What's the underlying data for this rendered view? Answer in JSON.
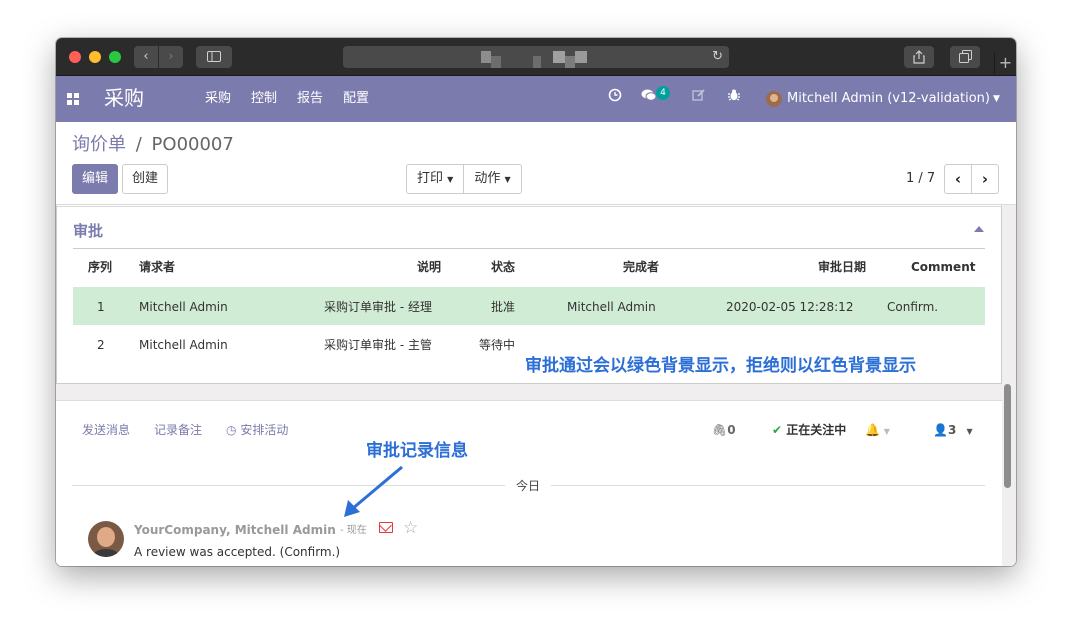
{
  "browser": {
    "back_icon": "chevron-left-icon",
    "forward_icon": "chevron-right-icon",
    "sidebar_icon": "sidebar-icon",
    "reload_icon": "reload-icon",
    "share_icon": "share-icon",
    "tabs_icon": "tabs-icon",
    "new_tab_icon": "plus-icon"
  },
  "navbar": {
    "app_name": "采购",
    "menu": [
      "采购",
      "控制",
      "报告",
      "配置"
    ],
    "messages_badge": "4",
    "user": "Mitchell Admin (v12-validation)",
    "color": "#7c7bad"
  },
  "control_panel": {
    "breadcrumb_parent": "询价单",
    "breadcrumb_sep": "/",
    "breadcrumb_current": "PO00007",
    "edit_label": "编辑",
    "create_label": "创建",
    "print_label": "打印",
    "action_label": "动作",
    "pager": "1 / 7"
  },
  "approval": {
    "section_title": "审批",
    "columns": [
      "序列",
      "请求者",
      "说明",
      "状态",
      "完成者",
      "审批日期",
      "Comment"
    ],
    "rows": [
      {
        "seq": "1",
        "requester": "Mitchell Admin",
        "description": "采购订单审批 - 经理",
        "status": "批准",
        "done_by": "Mitchell Admin",
        "date": "2020-02-05 12:28:12",
        "comment": "Confirm."
      },
      {
        "seq": "2",
        "requester": "Mitchell Admin",
        "description": "采购订单审批 - 主管",
        "status": "等待中",
        "done_by": "",
        "date": "",
        "comment": ""
      }
    ],
    "approved_row_color": "#d1ecd5",
    "annotation": "审批通过会以绿色背景显示，拒绝则以红色背景显示"
  },
  "chatter": {
    "send_message": "发送消息",
    "log_note": "记录备注",
    "schedule_activity": "安排活动",
    "attachments": "0",
    "following": "正在关注中",
    "followers": "3",
    "annotation": "审批记录信息",
    "today_label": "今日",
    "message": {
      "author": "YourCompany, Mitchell Admin",
      "time": "- 现在",
      "body": "A review was accepted. (Confirm.)"
    }
  },
  "annotation_color": "#2c6fd6"
}
